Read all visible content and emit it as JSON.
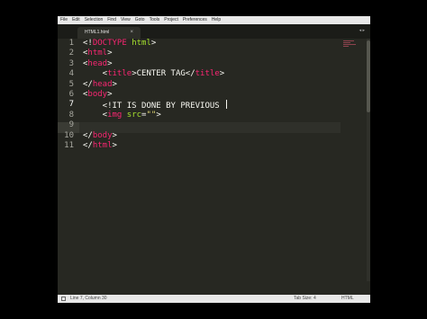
{
  "menu": [
    "File",
    "Edit",
    "Selection",
    "Find",
    "View",
    "Goto",
    "Tools",
    "Project",
    "Preferences",
    "Help"
  ],
  "tab": {
    "label": "HTML1.html",
    "close": "×"
  },
  "tab_arrows": "◂ ▸",
  "line_numbers": [
    "1",
    "2",
    "3",
    "4",
    "5",
    "6",
    "7",
    "8",
    "9",
    "10",
    "11"
  ],
  "code_lines": [
    [
      {
        "t": "<!",
        "c": "plain"
      },
      {
        "t": "DOCTYPE",
        "c": "tag"
      },
      {
        "t": " ",
        "c": "plain"
      },
      {
        "t": "html",
        "c": "attr"
      },
      {
        "t": ">",
        "c": "plain"
      }
    ],
    [
      {
        "t": "<",
        "c": "plain"
      },
      {
        "t": "html",
        "c": "tag"
      },
      {
        "t": ">",
        "c": "plain"
      }
    ],
    [
      {
        "t": "<",
        "c": "plain"
      },
      {
        "t": "head",
        "c": "tag"
      },
      {
        "t": ">",
        "c": "plain"
      }
    ],
    [
      {
        "t": "    <",
        "c": "plain"
      },
      {
        "t": "title",
        "c": "tag"
      },
      {
        "t": ">CENTER TAG</",
        "c": "plain"
      },
      {
        "t": "title",
        "c": "tag"
      },
      {
        "t": ">",
        "c": "plain"
      }
    ],
    [
      {
        "t": "</",
        "c": "plain"
      },
      {
        "t": "head",
        "c": "tag"
      },
      {
        "t": ">",
        "c": "plain"
      }
    ],
    [
      {
        "t": "<",
        "c": "plain"
      },
      {
        "t": "body",
        "c": "tag"
      },
      {
        "t": ">",
        "c": "plain"
      }
    ],
    [
      {
        "t": "    <!IT IS DONE BY PREVIOUS ",
        "c": "plain"
      }
    ],
    [
      {
        "t": "    <",
        "c": "plain"
      },
      {
        "t": "img",
        "c": "tag"
      },
      {
        "t": " ",
        "c": "plain"
      },
      {
        "t": "src",
        "c": "attr"
      },
      {
        "t": "=",
        "c": "plain"
      },
      {
        "t": "\"\"",
        "c": "str"
      },
      {
        "t": ">",
        "c": "plain"
      }
    ],
    [],
    [
      {
        "t": "</",
        "c": "plain"
      },
      {
        "t": "body",
        "c": "tag"
      },
      {
        "t": ">",
        "c": "plain"
      }
    ],
    [
      {
        "t": "</",
        "c": "plain"
      },
      {
        "t": "html",
        "c": "tag"
      },
      {
        "t": ">",
        "c": "plain"
      }
    ]
  ],
  "cursor_line": 7,
  "status": {
    "position": "Line 7, Column 30",
    "tab_size": "Tab Size: 4",
    "syntax": "HTML"
  },
  "colors": {
    "editor_bg": "#272822",
    "tag": "#f92672",
    "attr": "#a6e22e",
    "string": "#e6db74",
    "text": "#f8f8f2"
  }
}
